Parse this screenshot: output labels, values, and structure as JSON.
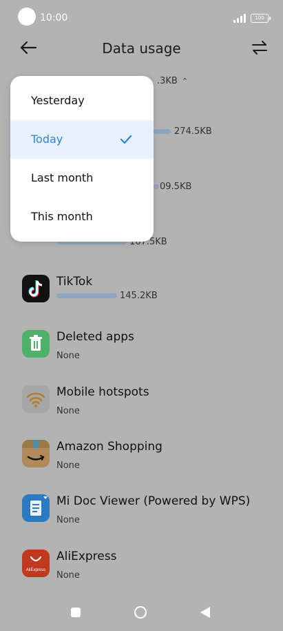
{
  "status_bar": {
    "time": "10:00",
    "battery": "100"
  },
  "header": {
    "title": "Data usage"
  },
  "summary": {
    "total_suffix": ".3KB"
  },
  "covered_rows": [
    {
      "value": "274.5KB"
    },
    {
      "value": "09.5KB"
    },
    {
      "value": "167.5KB"
    }
  ],
  "dropdown": {
    "items": [
      {
        "label": "Yesterday"
      },
      {
        "label": "Today"
      },
      {
        "label": "Last month"
      },
      {
        "label": "This month"
      }
    ],
    "selected": "Today"
  },
  "apps": [
    {
      "name": "TikTok",
      "usage": "145.2KB",
      "icon": "tiktok-icon",
      "fraction": 0.53
    },
    {
      "name": "Deleted apps",
      "usage": "None",
      "icon": "trash-icon"
    },
    {
      "name": "Mobile hotspots",
      "usage": "None",
      "icon": "wifi-icon"
    },
    {
      "name": "Amazon Shopping",
      "usage": "None",
      "icon": "amazon-icon"
    },
    {
      "name": "Mi Doc Viewer (Powered by WPS)",
      "usage": "None",
      "icon": "document-icon"
    },
    {
      "name": "AliExpress",
      "usage": "None",
      "icon": "aliexpress-icon",
      "icon_text": "AliExpress"
    }
  ],
  "colors": {
    "accent": "#2a87d4",
    "bar": "#8fa5bd",
    "selected_bg": "#e6f1fc"
  }
}
